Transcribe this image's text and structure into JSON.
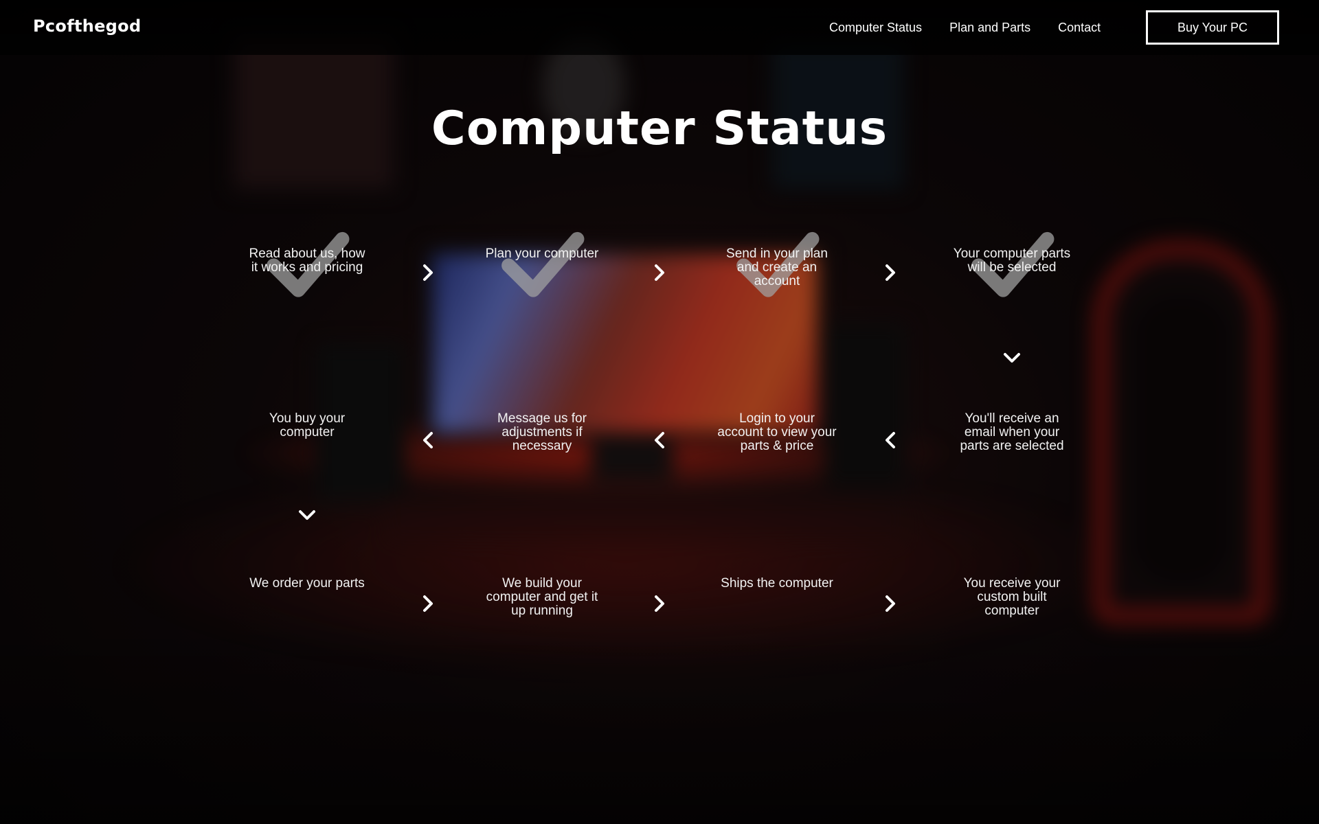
{
  "header": {
    "logo": "Pcofthegod",
    "nav": [
      {
        "label": "Computer Status"
      },
      {
        "label": "Plan and Parts"
      },
      {
        "label": "Contact"
      }
    ],
    "cta_label": "Buy Your PC"
  },
  "main": {
    "title": "Computer Status",
    "steps": [
      {
        "label": "Read about us, how it works and pricing",
        "completed": true
      },
      {
        "label": "Plan your computer",
        "completed": true
      },
      {
        "label": "Send in your plan and create an account",
        "completed": true
      },
      {
        "label": "Your computer parts will be selected",
        "completed": true
      },
      {
        "label": "You'll receive an email when your parts are selected",
        "completed": false
      },
      {
        "label": "Login to your account to view your parts & price",
        "completed": false
      },
      {
        "label": "Message us for adjustments if necessary",
        "completed": false
      },
      {
        "label": "You buy your computer",
        "completed": false
      },
      {
        "label": "We order your parts",
        "completed": false
      },
      {
        "label": "We build your computer and get it up running",
        "completed": false
      },
      {
        "label": "Ships the computer",
        "completed": false
      },
      {
        "label": "You receive your custom built computer",
        "completed": false
      }
    ],
    "icons": {
      "check": "checkmark-icon",
      "arrow_right": "chevron-right-icon",
      "arrow_left": "chevron-left-icon",
      "arrow_down": "chevron-down-icon"
    }
  },
  "colors": {
    "text": "#ffffff",
    "header_bg": "#000000",
    "check": "#9a9a9a"
  }
}
